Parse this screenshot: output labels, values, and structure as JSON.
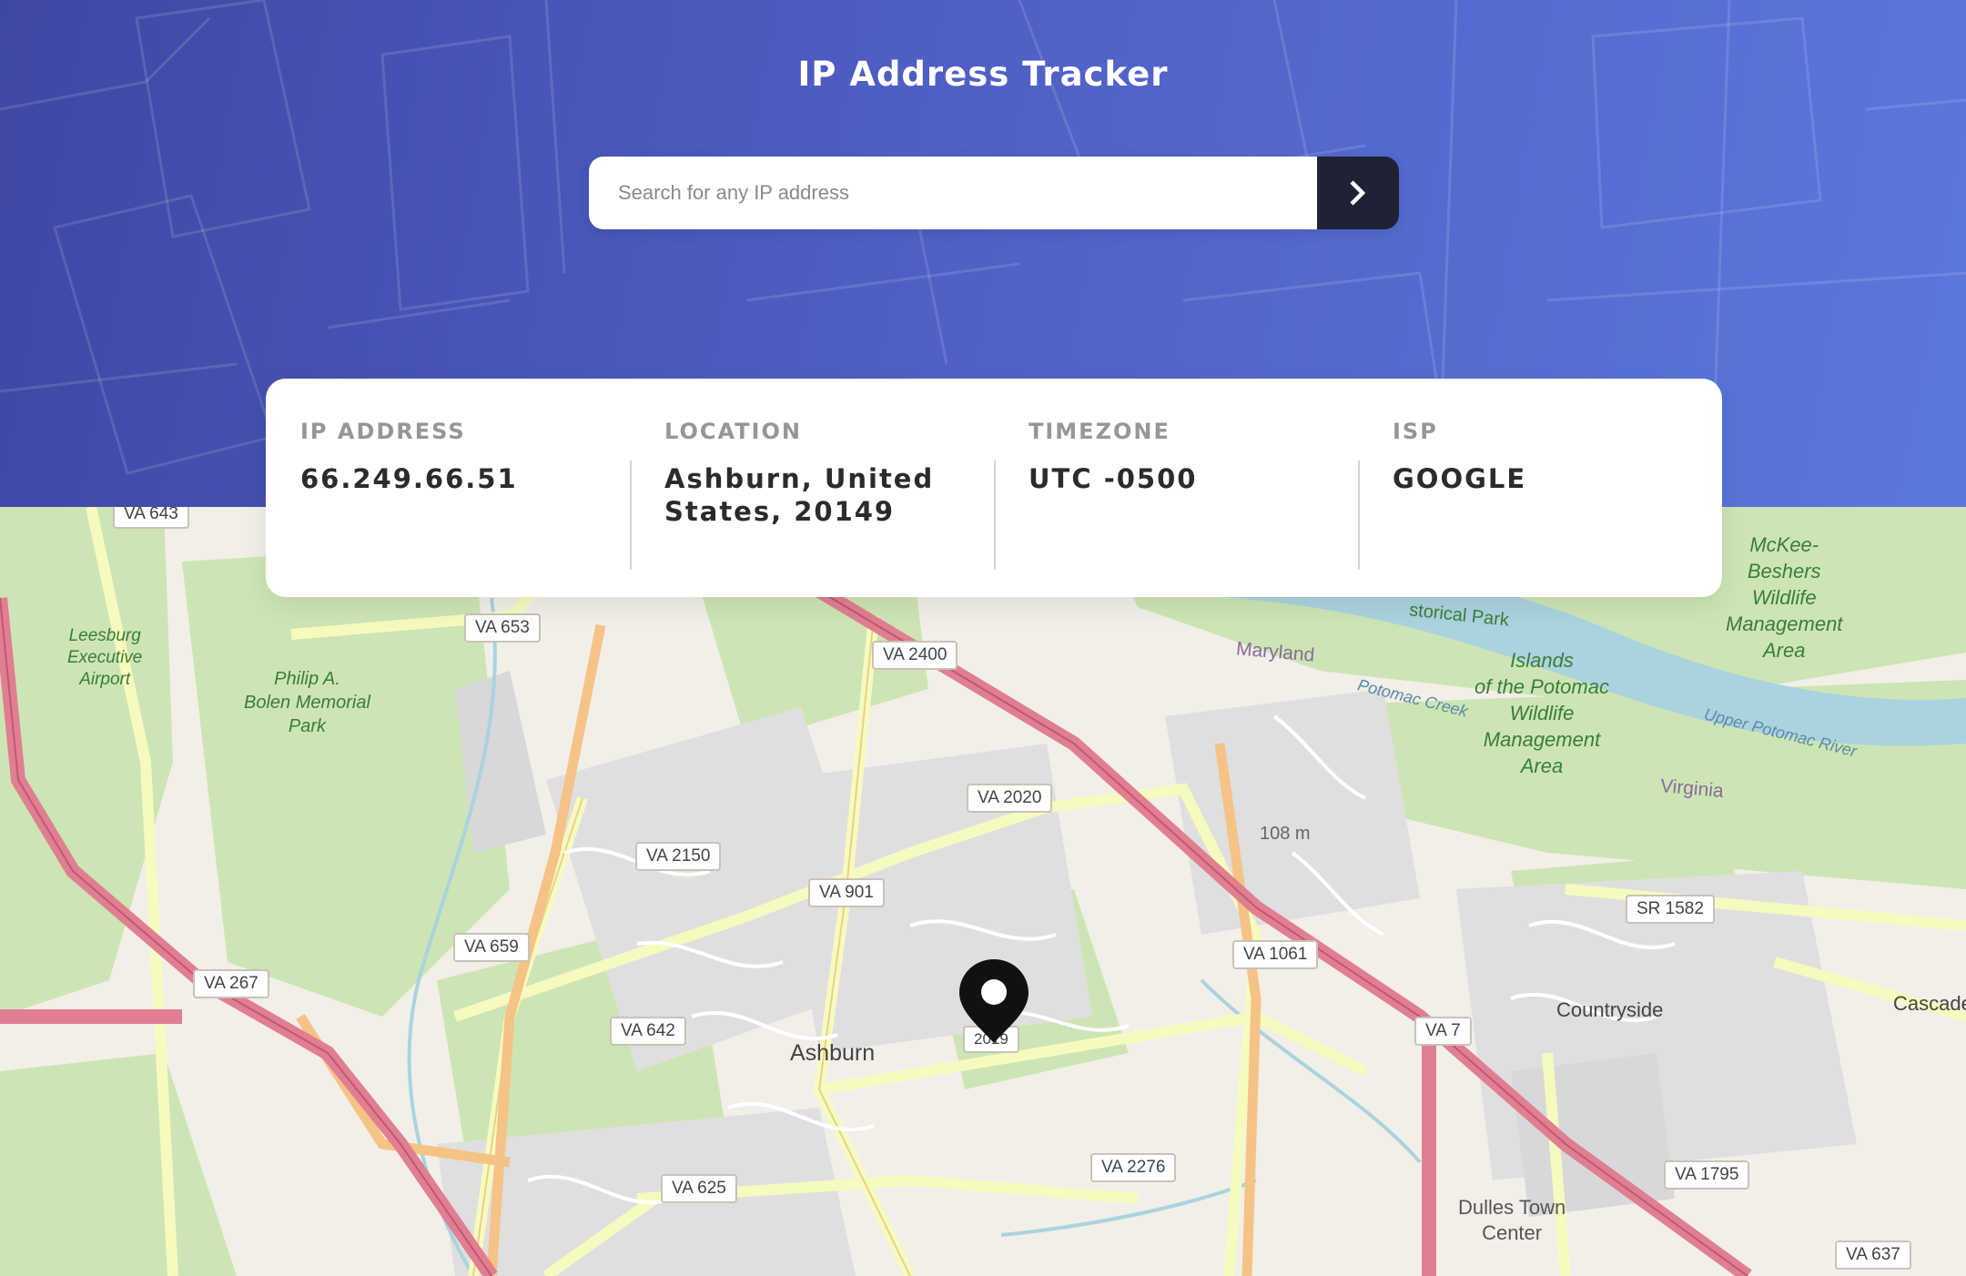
{
  "header": {
    "title": "IP Address Tracker",
    "search_placeholder": "Search for any IP address",
    "submit_icon": "chevron-right-icon"
  },
  "info": {
    "ip": {
      "label": "IP ADDRESS",
      "value": "66.249.66.51"
    },
    "location": {
      "label": "LOCATION",
      "value_line1": "Ashburn, United",
      "value_line2": "States, 20149"
    },
    "timezone": {
      "label": "TIMEZONE",
      "value": "UTC -0500"
    },
    "isp": {
      "label": "ISP",
      "value": "GOOGLE"
    }
  },
  "map": {
    "marker_icon": "location-pin-icon",
    "town_ashburn": "Ashburn",
    "town_countryside": "Countryside",
    "town_cascade": "Cascade",
    "dulles_town_center_1": "Dulles Town",
    "dulles_town_center_2": "Center",
    "maryland": "Maryland",
    "virginia": "Virginia",
    "elevation": "108 m",
    "airport_1": "Leesburg",
    "airport_2": "Executive",
    "airport_3": "Airport",
    "park_1": "Philip A.",
    "park_2": "Bolen Memorial",
    "park_3": "Park",
    "islands_1": "Islands",
    "islands_2": "of the Potomac",
    "islands_3": "Wildlife",
    "islands_4": "Management",
    "islands_5": "Area",
    "mckee_1": "McKee-",
    "mckee_2": "Beshers",
    "mckee_3": "Wildlife",
    "mckee_4": "Management",
    "mckee_5": "Area",
    "historical_park": "storical Park",
    "potomac_creek": "Potomac Creek",
    "upper_potomac": "Upper Potomac River",
    "shields": [
      "VA 643",
      "VA 653",
      "VA 2400",
      "VA 2020",
      "VA 2150",
      "VA 901",
      "VA 659",
      "VA 267",
      "VA 642",
      "VA 1061",
      "SR 1582",
      "VA 7",
      "VA 2276",
      "VA 625",
      "VA 1795",
      "VA 637",
      "2019"
    ]
  }
}
